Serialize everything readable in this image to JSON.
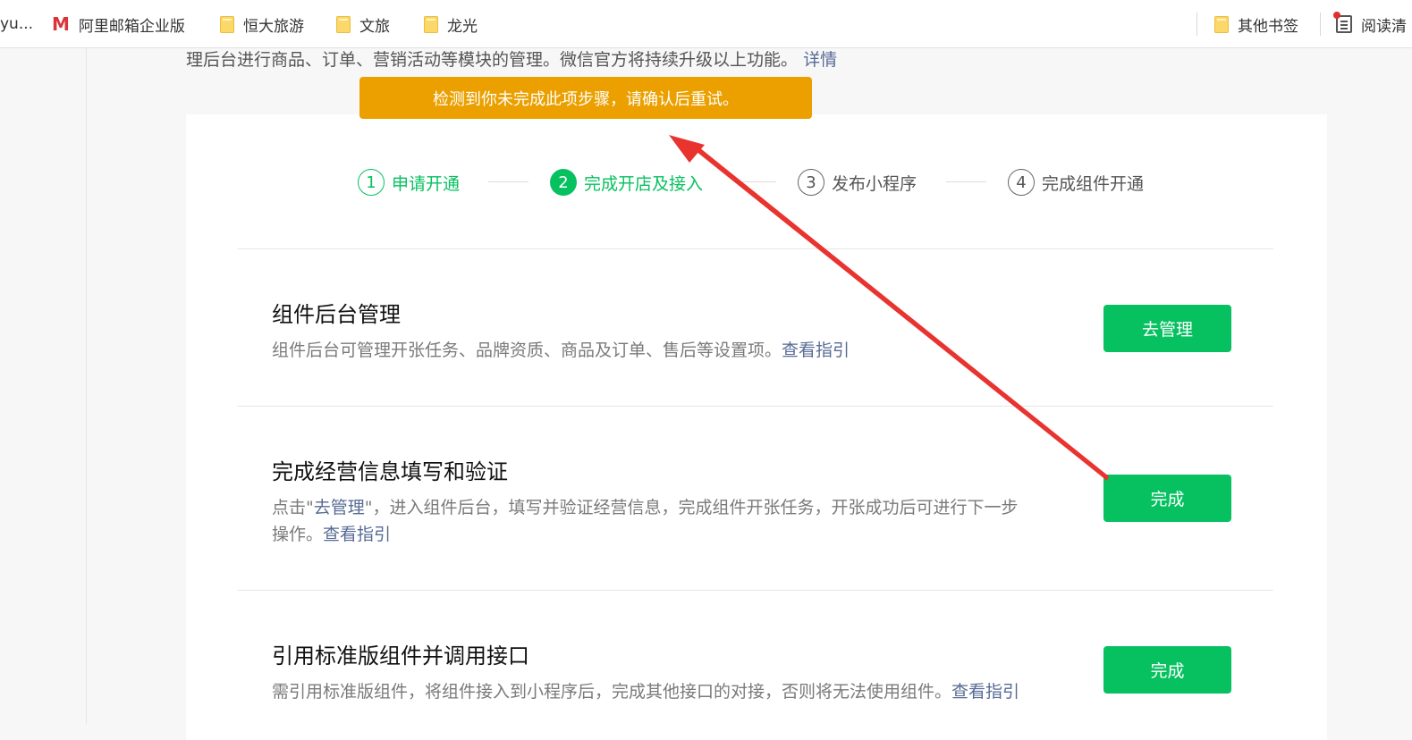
{
  "bookmarks_bar": {
    "cut_left": "yu...",
    "items": [
      {
        "label": "阿里邮箱企业版",
        "icon": "mail-logo-icon"
      },
      {
        "label": "恒大旅游",
        "icon": "folder-icon"
      },
      {
        "label": "文旅",
        "icon": "folder-icon"
      },
      {
        "label": "龙光",
        "icon": "folder-icon"
      }
    ],
    "other_bookmarks": "其他书签",
    "reading_list": "阅读清"
  },
  "intro": {
    "text": "理后台进行商品、订单、营销活动等模块的管理。微信官方将持续升级以上功能。",
    "link": "详情"
  },
  "toast": {
    "text": "检测到你未完成此项步骤，请确认后重试。",
    "color": "#eba000"
  },
  "steps": [
    {
      "num": "1",
      "label": "申请开通",
      "state": "done"
    },
    {
      "num": "2",
      "label": "完成开店及接入",
      "state": "active"
    },
    {
      "num": "3",
      "label": "发布小程序",
      "state": "todo"
    },
    {
      "num": "4",
      "label": "完成组件开通",
      "state": "todo"
    }
  ],
  "sections": [
    {
      "title": "组件后台管理",
      "desc": "组件后台可管理开张任务、品牌资质、商品及订单、售后等设置项。",
      "link": "查看指引",
      "button": "去管理"
    },
    {
      "title": "完成经营信息填写和验证",
      "desc_pre": "点击\"",
      "desc_link_inline": "去管理",
      "desc_line1_rest": "\"，进入组件后台，填写并验证经营信息，完成组件开张任务，开张成功后可进行下一步",
      "desc_line2": "操作。",
      "link": "查看指引",
      "button": "完成"
    },
    {
      "title": "引用标准版组件并调用接口",
      "desc": "需引用标准版组件，将组件接入到小程序后，完成其他接口的对接，否则将无法使用组件。",
      "link": "查看指引",
      "button": "完成"
    }
  ],
  "colors": {
    "primary": "#07c160",
    "link": "#576b95",
    "annotation_arrow": "#e8332f"
  }
}
